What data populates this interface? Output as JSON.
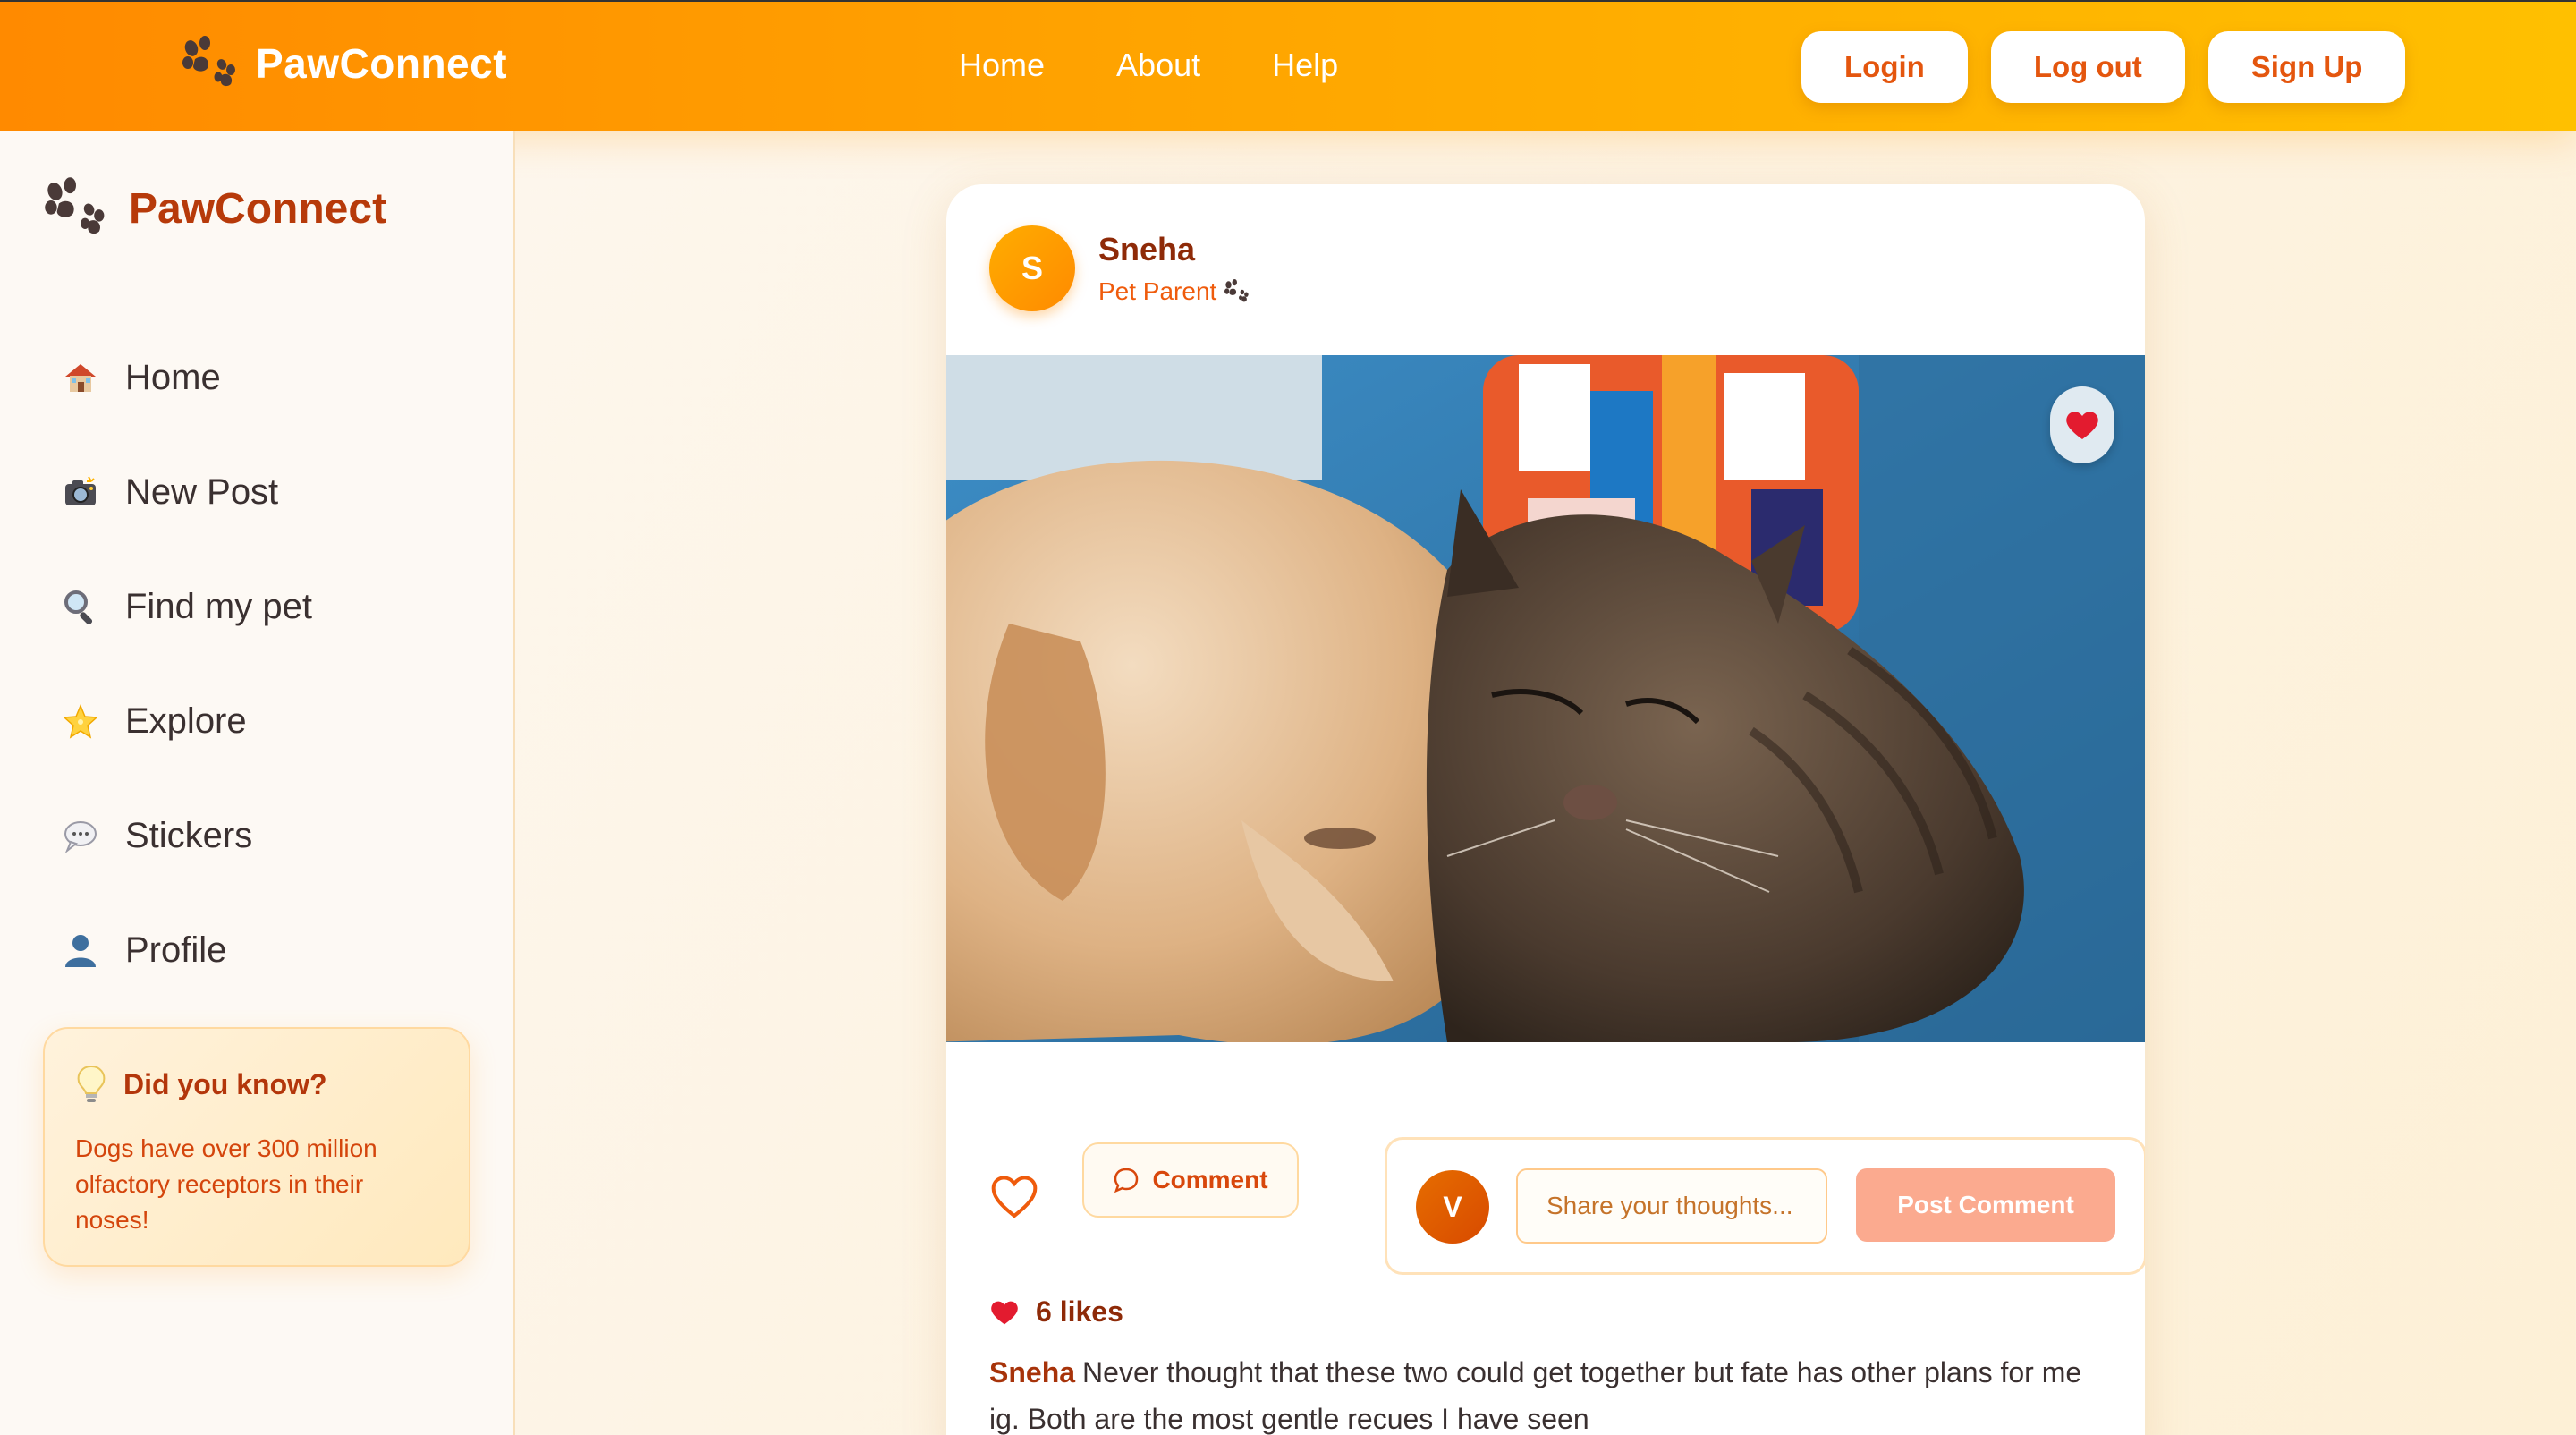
{
  "topbar": {
    "brand": "PawConnect",
    "nav": [
      "Home",
      "About",
      "Help"
    ],
    "actions": [
      "Login",
      "Log out",
      "Sign Up"
    ]
  },
  "sidebar": {
    "brand": "PawConnect",
    "items": [
      {
        "label": "Home",
        "icon": "house-icon"
      },
      {
        "label": "New Post",
        "icon": "camera-icon"
      },
      {
        "label": "Find my pet",
        "icon": "magnifier-icon"
      },
      {
        "label": "Explore",
        "icon": "star-icon"
      },
      {
        "label": "Stickers",
        "icon": "speech-bubble-icon"
      },
      {
        "label": "Profile",
        "icon": "user-icon"
      }
    ],
    "fact": {
      "title": "Did you know?",
      "body": "Dogs have over 300 million olfactory receptors in their noses!"
    }
  },
  "post": {
    "avatar_initial": "S",
    "author": "Sneha",
    "role": "Pet Parent",
    "image_alt": "dog-and-cat-cuddling-photo",
    "actions": {
      "comment_label": "Comment",
      "commenter_initial": "V",
      "input_placeholder": "Share your thoughts...",
      "post_comment_label": "Post Comment"
    },
    "likes": "6 likes",
    "caption_author": "Sneha",
    "caption_text": "Never thought that these two could get together but fate has other plans for me ig. Both are the most gentle recues I have seen"
  },
  "colors": {
    "accent": "#ff8a00",
    "brand_text": "#b73a0a",
    "button_text": "#e4560e",
    "post_comment_bg": "#fbaa8f"
  }
}
